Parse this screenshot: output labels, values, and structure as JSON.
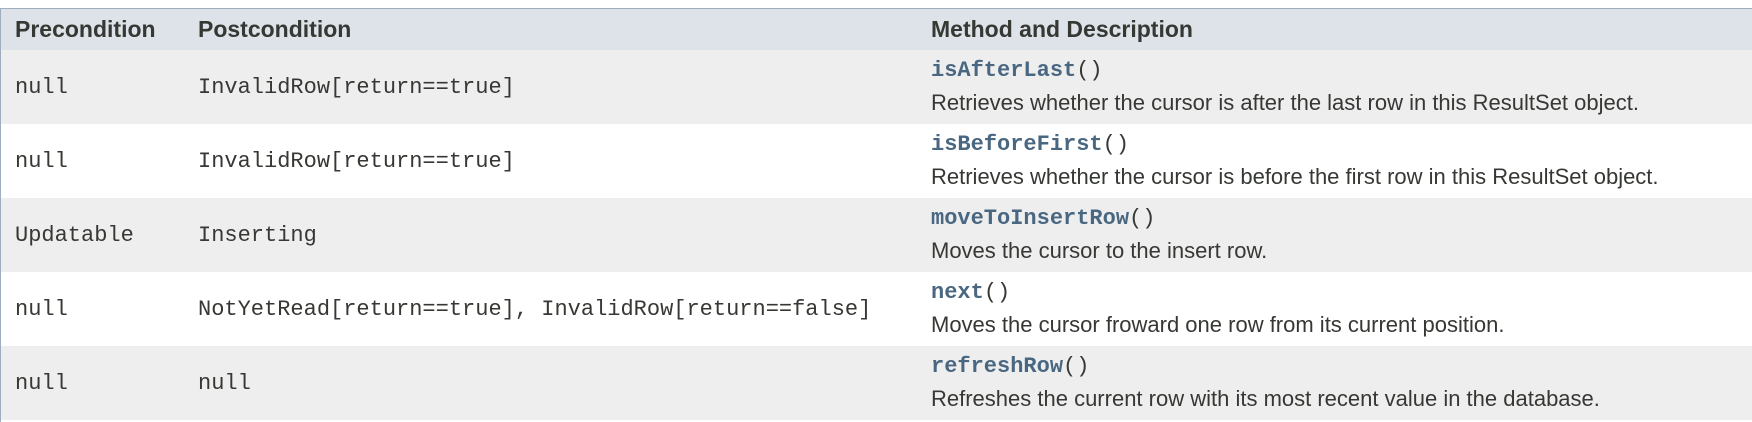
{
  "table": {
    "headers": [
      "Precondition",
      "Postcondition",
      "Method and Description"
    ],
    "rows": [
      {
        "precondition": "null",
        "postcondition": "InvalidRow[return==true]",
        "method": "isAfterLast",
        "parens": "()",
        "description": "Retrieves whether the cursor is after the last row in this ResultSet object."
      },
      {
        "precondition": "null",
        "postcondition": "InvalidRow[return==true]",
        "method": "isBeforeFirst",
        "parens": "()",
        "description": "Retrieves whether the cursor is before the first row in this ResultSet object."
      },
      {
        "precondition": "Updatable",
        "postcondition": "Inserting",
        "method": "moveToInsertRow",
        "parens": "()",
        "description": "Moves the cursor to the insert row."
      },
      {
        "precondition": "null",
        "postcondition": "NotYetRead[return==true], InvalidRow[return==false]",
        "method": "next",
        "parens": "()",
        "description": "Moves the cursor froward one row from its current position."
      },
      {
        "precondition": "null",
        "postcondition": "null",
        "method": "refreshRow",
        "parens": "()",
        "description": "Refreshes the current row with its most recent value in the database."
      }
    ]
  },
  "colors": {
    "header_bg": "#dee3e9",
    "alt_row_bg": "#eeeeef",
    "link": "#4a6782",
    "text": "#353833"
  }
}
